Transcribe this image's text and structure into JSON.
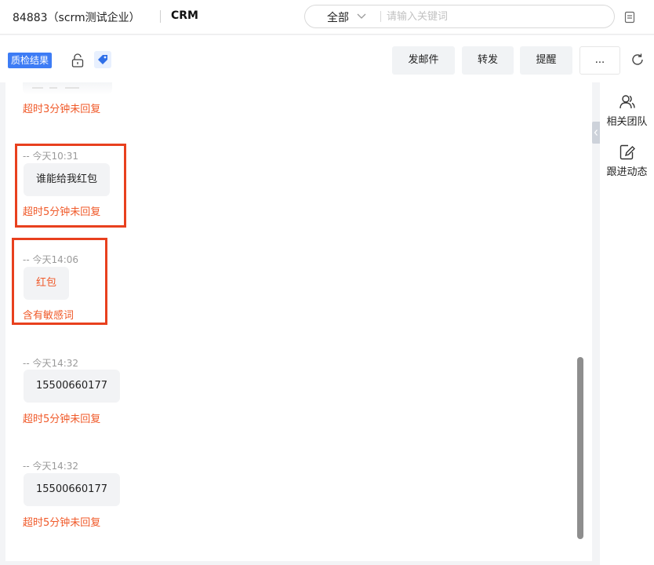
{
  "header": {
    "company": "84883（scrm测试企业）",
    "product": "CRM",
    "search": {
      "scope": "全部",
      "placeholder": "请输入关键词"
    }
  },
  "toolbar": {
    "qc_badge": "质检结果",
    "buttons": {
      "email": "发邮件",
      "forward": "转发",
      "remind": "提醒",
      "more": "..."
    }
  },
  "chat": {
    "top_warning": "超时3分钟未回复",
    "messages": [
      {
        "time": "-- 今天10:31",
        "text": "谁能给我红包",
        "warning": "超时5分钟未回复",
        "highlighted": true,
        "sensitive": false
      },
      {
        "time": "-- 今天14:06",
        "text": "红包",
        "warning": "含有敏感词",
        "highlighted": true,
        "sensitive": true
      },
      {
        "time": "-- 今天14:32",
        "text": "15500660177",
        "warning": "超时5分钟未回复",
        "highlighted": false,
        "sensitive": false
      },
      {
        "time": "-- 今天14:32",
        "text": "15500660177",
        "warning": "超时5分钟未回复",
        "highlighted": false,
        "sensitive": false
      }
    ]
  },
  "sidebar": {
    "items": [
      {
        "label": "相关团队",
        "icon": "team-icon"
      },
      {
        "label": "跟进动态",
        "icon": "edit-note-icon"
      }
    ]
  },
  "colors": {
    "accent": "#3d7cf5",
    "warning": "#f05a2a",
    "highlight": "#e8401e"
  }
}
